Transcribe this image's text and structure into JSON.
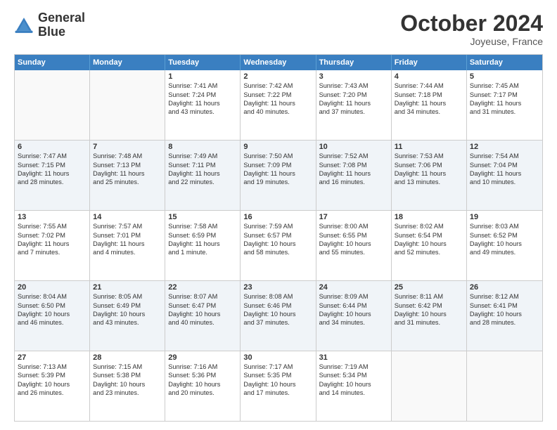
{
  "logo": {
    "line1": "General",
    "line2": "Blue"
  },
  "header": {
    "month": "October 2024",
    "location": "Joyeuse, France"
  },
  "days": [
    "Sunday",
    "Monday",
    "Tuesday",
    "Wednesday",
    "Thursday",
    "Friday",
    "Saturday"
  ],
  "rows": [
    [
      {
        "day": "",
        "lines": []
      },
      {
        "day": "",
        "lines": []
      },
      {
        "day": "1",
        "lines": [
          "Sunrise: 7:41 AM",
          "Sunset: 7:24 PM",
          "Daylight: 11 hours",
          "and 43 minutes."
        ]
      },
      {
        "day": "2",
        "lines": [
          "Sunrise: 7:42 AM",
          "Sunset: 7:22 PM",
          "Daylight: 11 hours",
          "and 40 minutes."
        ]
      },
      {
        "day": "3",
        "lines": [
          "Sunrise: 7:43 AM",
          "Sunset: 7:20 PM",
          "Daylight: 11 hours",
          "and 37 minutes."
        ]
      },
      {
        "day": "4",
        "lines": [
          "Sunrise: 7:44 AM",
          "Sunset: 7:18 PM",
          "Daylight: 11 hours",
          "and 34 minutes."
        ]
      },
      {
        "day": "5",
        "lines": [
          "Sunrise: 7:45 AM",
          "Sunset: 7:17 PM",
          "Daylight: 11 hours",
          "and 31 minutes."
        ]
      }
    ],
    [
      {
        "day": "6",
        "lines": [
          "Sunrise: 7:47 AM",
          "Sunset: 7:15 PM",
          "Daylight: 11 hours",
          "and 28 minutes."
        ]
      },
      {
        "day": "7",
        "lines": [
          "Sunrise: 7:48 AM",
          "Sunset: 7:13 PM",
          "Daylight: 11 hours",
          "and 25 minutes."
        ]
      },
      {
        "day": "8",
        "lines": [
          "Sunrise: 7:49 AM",
          "Sunset: 7:11 PM",
          "Daylight: 11 hours",
          "and 22 minutes."
        ]
      },
      {
        "day": "9",
        "lines": [
          "Sunrise: 7:50 AM",
          "Sunset: 7:09 PM",
          "Daylight: 11 hours",
          "and 19 minutes."
        ]
      },
      {
        "day": "10",
        "lines": [
          "Sunrise: 7:52 AM",
          "Sunset: 7:08 PM",
          "Daylight: 11 hours",
          "and 16 minutes."
        ]
      },
      {
        "day": "11",
        "lines": [
          "Sunrise: 7:53 AM",
          "Sunset: 7:06 PM",
          "Daylight: 11 hours",
          "and 13 minutes."
        ]
      },
      {
        "day": "12",
        "lines": [
          "Sunrise: 7:54 AM",
          "Sunset: 7:04 PM",
          "Daylight: 11 hours",
          "and 10 minutes."
        ]
      }
    ],
    [
      {
        "day": "13",
        "lines": [
          "Sunrise: 7:55 AM",
          "Sunset: 7:02 PM",
          "Daylight: 11 hours",
          "and 7 minutes."
        ]
      },
      {
        "day": "14",
        "lines": [
          "Sunrise: 7:57 AM",
          "Sunset: 7:01 PM",
          "Daylight: 11 hours",
          "and 4 minutes."
        ]
      },
      {
        "day": "15",
        "lines": [
          "Sunrise: 7:58 AM",
          "Sunset: 6:59 PM",
          "Daylight: 11 hours",
          "and 1 minute."
        ]
      },
      {
        "day": "16",
        "lines": [
          "Sunrise: 7:59 AM",
          "Sunset: 6:57 PM",
          "Daylight: 10 hours",
          "and 58 minutes."
        ]
      },
      {
        "day": "17",
        "lines": [
          "Sunrise: 8:00 AM",
          "Sunset: 6:55 PM",
          "Daylight: 10 hours",
          "and 55 minutes."
        ]
      },
      {
        "day": "18",
        "lines": [
          "Sunrise: 8:02 AM",
          "Sunset: 6:54 PM",
          "Daylight: 10 hours",
          "and 52 minutes."
        ]
      },
      {
        "day": "19",
        "lines": [
          "Sunrise: 8:03 AM",
          "Sunset: 6:52 PM",
          "Daylight: 10 hours",
          "and 49 minutes."
        ]
      }
    ],
    [
      {
        "day": "20",
        "lines": [
          "Sunrise: 8:04 AM",
          "Sunset: 6:50 PM",
          "Daylight: 10 hours",
          "and 46 minutes."
        ]
      },
      {
        "day": "21",
        "lines": [
          "Sunrise: 8:05 AM",
          "Sunset: 6:49 PM",
          "Daylight: 10 hours",
          "and 43 minutes."
        ]
      },
      {
        "day": "22",
        "lines": [
          "Sunrise: 8:07 AM",
          "Sunset: 6:47 PM",
          "Daylight: 10 hours",
          "and 40 minutes."
        ]
      },
      {
        "day": "23",
        "lines": [
          "Sunrise: 8:08 AM",
          "Sunset: 6:46 PM",
          "Daylight: 10 hours",
          "and 37 minutes."
        ]
      },
      {
        "day": "24",
        "lines": [
          "Sunrise: 8:09 AM",
          "Sunset: 6:44 PM",
          "Daylight: 10 hours",
          "and 34 minutes."
        ]
      },
      {
        "day": "25",
        "lines": [
          "Sunrise: 8:11 AM",
          "Sunset: 6:42 PM",
          "Daylight: 10 hours",
          "and 31 minutes."
        ]
      },
      {
        "day": "26",
        "lines": [
          "Sunrise: 8:12 AM",
          "Sunset: 6:41 PM",
          "Daylight: 10 hours",
          "and 28 minutes."
        ]
      }
    ],
    [
      {
        "day": "27",
        "lines": [
          "Sunrise: 7:13 AM",
          "Sunset: 5:39 PM",
          "Daylight: 10 hours",
          "and 26 minutes."
        ]
      },
      {
        "day": "28",
        "lines": [
          "Sunrise: 7:15 AM",
          "Sunset: 5:38 PM",
          "Daylight: 10 hours",
          "and 23 minutes."
        ]
      },
      {
        "day": "29",
        "lines": [
          "Sunrise: 7:16 AM",
          "Sunset: 5:36 PM",
          "Daylight: 10 hours",
          "and 20 minutes."
        ]
      },
      {
        "day": "30",
        "lines": [
          "Sunrise: 7:17 AM",
          "Sunset: 5:35 PM",
          "Daylight: 10 hours",
          "and 17 minutes."
        ]
      },
      {
        "day": "31",
        "lines": [
          "Sunrise: 7:19 AM",
          "Sunset: 5:34 PM",
          "Daylight: 10 hours",
          "and 14 minutes."
        ]
      },
      {
        "day": "",
        "lines": []
      },
      {
        "day": "",
        "lines": []
      }
    ]
  ]
}
